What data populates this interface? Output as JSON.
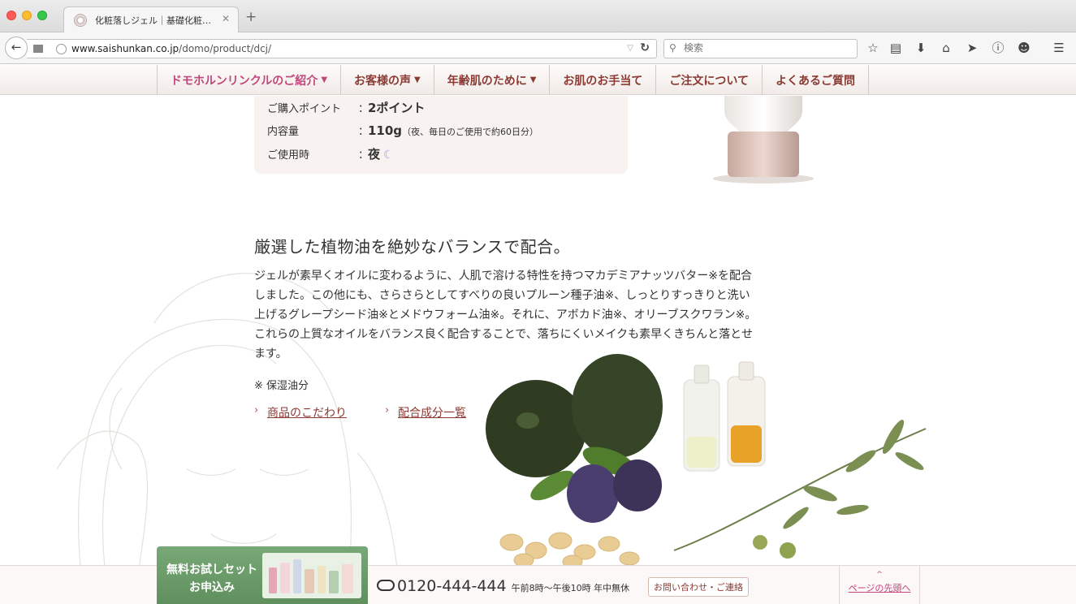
{
  "browser": {
    "tab_title": "化粧落しジェル｜基礎化粧…",
    "url_host": "www.saishunkan.co.jp",
    "url_path": "/domo/product/dcj/",
    "search_placeholder": "検索"
  },
  "site_nav": [
    {
      "label": "ドモホルンリンクルのご紹介",
      "caret": "▼"
    },
    {
      "label": "お客様の声",
      "caret": "▼"
    },
    {
      "label": "年齢肌のために",
      "caret": "▼"
    },
    {
      "label": "お肌のお手当て",
      "caret": ""
    },
    {
      "label": "ご注文について",
      "caret": ""
    },
    {
      "label": "よくあるご質問",
      "caret": ""
    }
  ],
  "product_info": {
    "points_label": "ご購入ポイント",
    "points_value": "2ポイント",
    "volume_label": "内容量",
    "volume_value": "110g",
    "volume_note": "（夜、毎日のご使用で約60日分）",
    "time_label": "ご使用時",
    "time_value": "夜",
    "separator": "："
  },
  "section": {
    "heading": "厳選した植物油を絶妙なバランスで配合。",
    "paragraph": [
      "ジェルが素早くオイルに変わるように、人肌で溶ける特性を持つマカデミアナッツバター※を配合",
      "しました。この他にも、さらさらとしてすべりの良いプルーン種子油※、しっとりすっきりと洗い",
      "上げるグレープシード油※とメドウフォーム油※。それに、アボカド油※、オリーブスクワラン※。",
      "これらの上質なオイルをバランス良く配合することで、落ちにくいメイクも素早くきちんと落とせ",
      "ます。"
    ],
    "note": "※ 保湿油分",
    "link1": "商品のこだわり",
    "link2": "配合成分一覧"
  },
  "bottom_bar": {
    "trial_line1": "無料お試しセット",
    "trial_line2": "お申込み",
    "phone": "0120-444-444",
    "hours": "午前8時〜午後10時 年中無休",
    "contact": "お問い合わせ・ご連絡",
    "pagetop_arrow": "^",
    "pagetop": "ページの先頭へ"
  },
  "colors": {
    "nav_text": "#8b3a33",
    "accent_pink": "#c1467b",
    "trial_green": "#5e8f5c"
  }
}
